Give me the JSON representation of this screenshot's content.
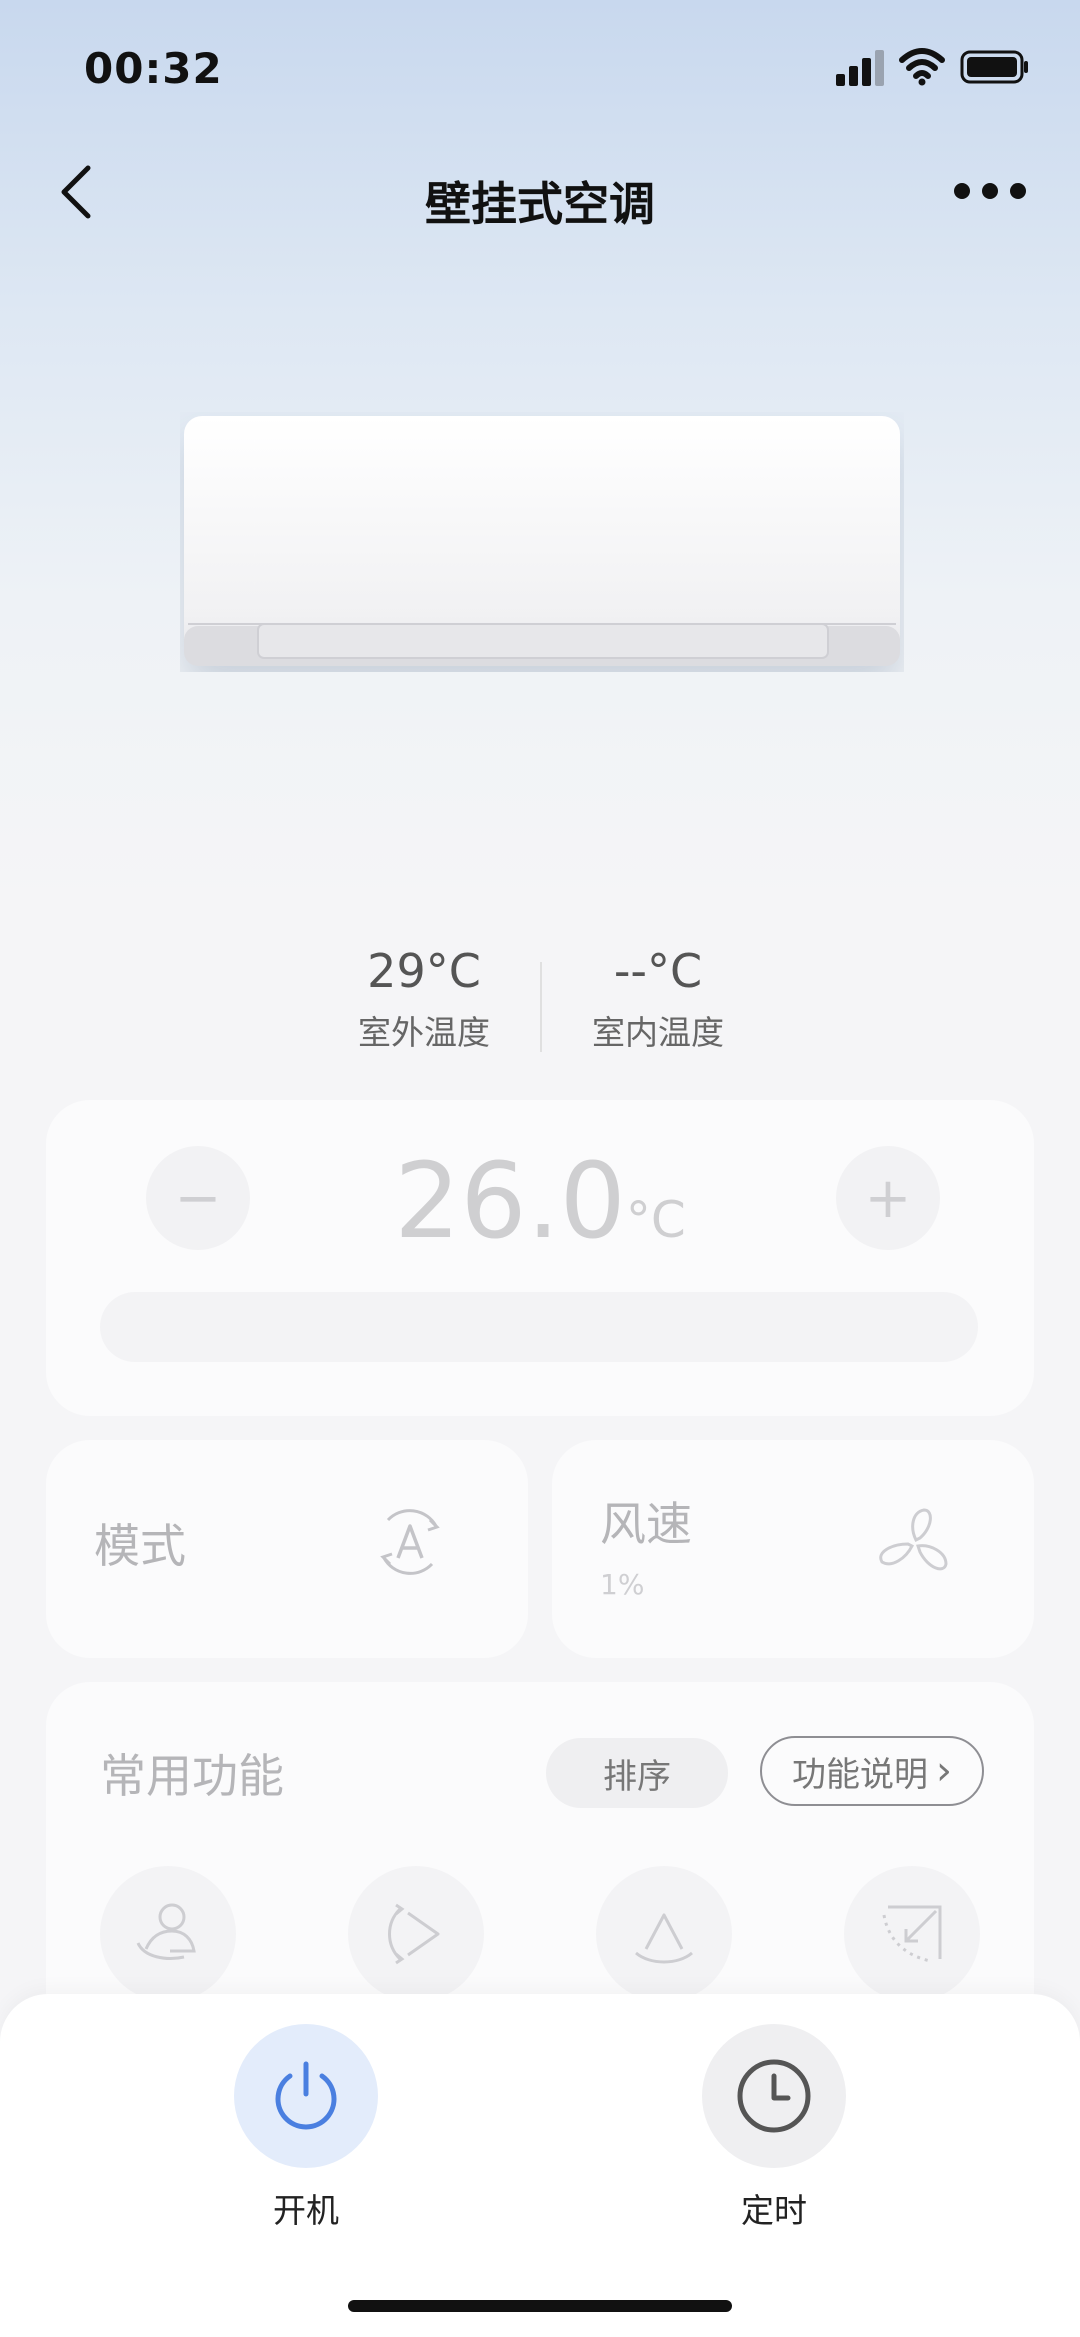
{
  "status_bar": {
    "time": "00:32"
  },
  "header": {
    "title": "壁挂式空调"
  },
  "temperatures": {
    "outdoor": {
      "value": "29°C",
      "label": "室外温度"
    },
    "indoor": {
      "value": "--°C",
      "label": "室内温度"
    }
  },
  "setpoint": {
    "value": "26.0",
    "unit": "°C",
    "minus": "−",
    "plus": "+"
  },
  "mode_card": {
    "label": "模式"
  },
  "fan_card": {
    "label": "风速",
    "value": "1%"
  },
  "functions": {
    "title": "常用功能",
    "sort_label": "排序",
    "help_label": "功能说明",
    "help_chevron": "›"
  },
  "actions": {
    "power_label": "开机",
    "timer_label": "定时"
  },
  "colors": {
    "accent": "#4a7fe0",
    "accent_bg": "#e3ecfb"
  }
}
